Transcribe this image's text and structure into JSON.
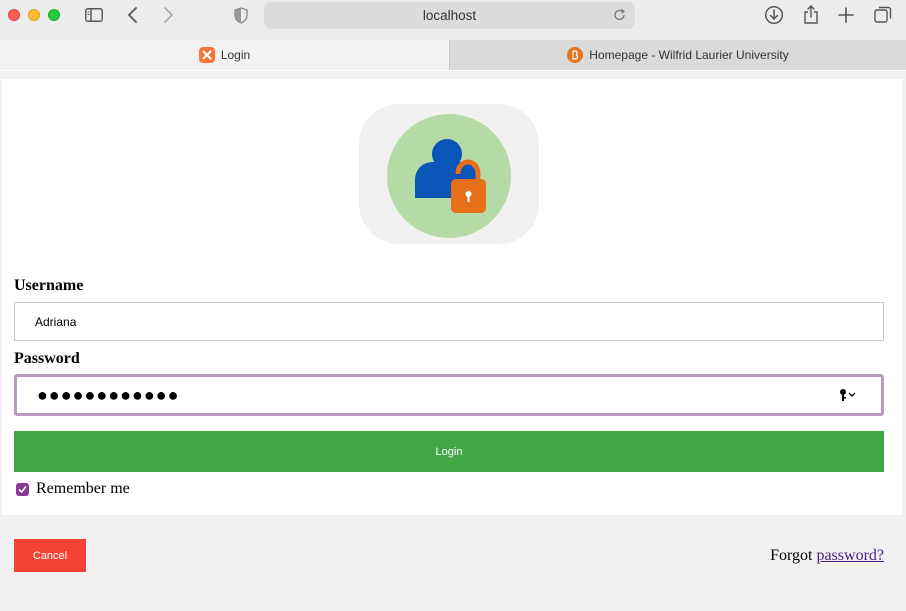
{
  "browser": {
    "address": "localhost",
    "tabs": [
      {
        "label": "Login",
        "active": true
      },
      {
        "label": "Homepage - Wilfrid Laurier University",
        "active": false
      }
    ]
  },
  "form": {
    "username_label": "Username",
    "username_value": "Adriana",
    "password_label": "Password",
    "password_masked": "●●●●●●●●●●●●",
    "login_label": "Login",
    "remember_label": "Remember me",
    "remember_checked": true
  },
  "footer": {
    "cancel_label": "Cancel",
    "forgot_prefix": "Forgot",
    "forgot_link": "password?"
  },
  "colors": {
    "login_button": "#41a744",
    "cancel_button": "#f44336",
    "password_focus_border": "#b89bc0",
    "link": "#4b1d80",
    "avatar_bg": "#b4dba5"
  },
  "icons": [
    "sidebar-icon",
    "back-icon",
    "forward-icon",
    "shield-icon",
    "reload-icon",
    "download-icon",
    "share-icon",
    "new-tab-icon",
    "tabs-overview-icon",
    "user-lock-icon",
    "key-icon",
    "checkmark-icon"
  ]
}
